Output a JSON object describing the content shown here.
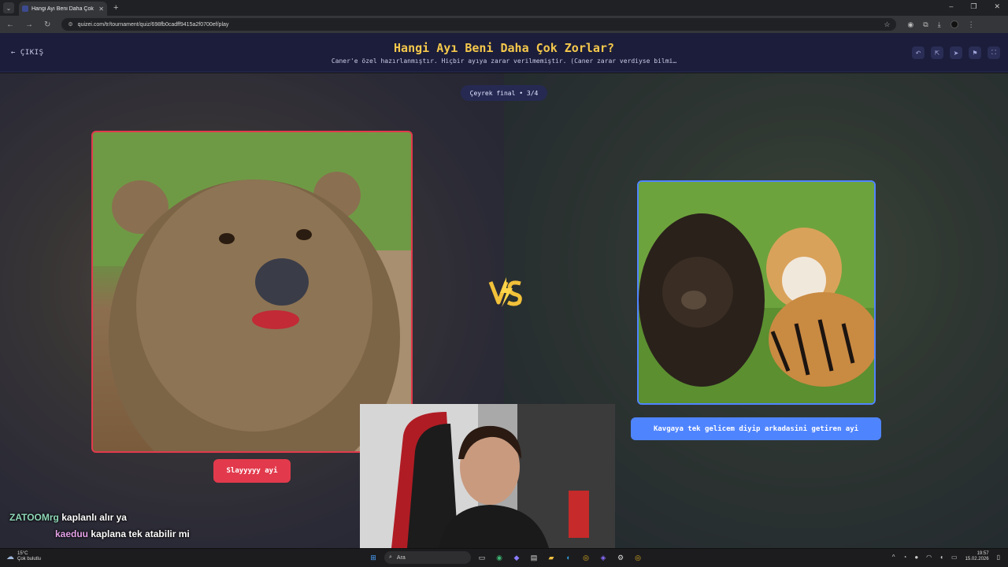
{
  "browser": {
    "tab_title": "Hangi Ayı Beni Daha Çok Zorla...",
    "url": "quizei.com/tr/tournament/quiz/698fb0cadff9415a2f0700ef/play"
  },
  "header": {
    "back_label": "ÇIKIŞ",
    "title": "Hangi Ayı Beni Daha Çok Zorlar?",
    "subtitle": "Caner'e özel hazırlanmıştır. Hiçbir ayıya zarar verilmemiştir. (Caner zarar verdiyse bilmi…"
  },
  "round": {
    "label": "Çeyrek final • 3/4"
  },
  "left_option": {
    "label": "Slayyyyy ayi"
  },
  "right_option": {
    "label": "Kavgaya tek gelicem diyip arkadasini getiren ayi"
  },
  "vs": {
    "text": "VS"
  },
  "chat": [
    {
      "user": "ZATOOMrg",
      "message": "kaplanlı alır ya"
    },
    {
      "user": "kaeduu",
      "message": "kaplana tek atabilir mi"
    }
  ],
  "taskbar": {
    "weather_temp": "15°C",
    "weather_desc": "Çok bulutlu",
    "search_label": "Ara",
    "time": "19:57",
    "date": "15.02.2026"
  },
  "colors": {
    "accent_red": "#e23a4c",
    "accent_blue": "#4f84ff",
    "title_yellow": "#f5c84c",
    "header_bg": "#1b1d3a"
  }
}
